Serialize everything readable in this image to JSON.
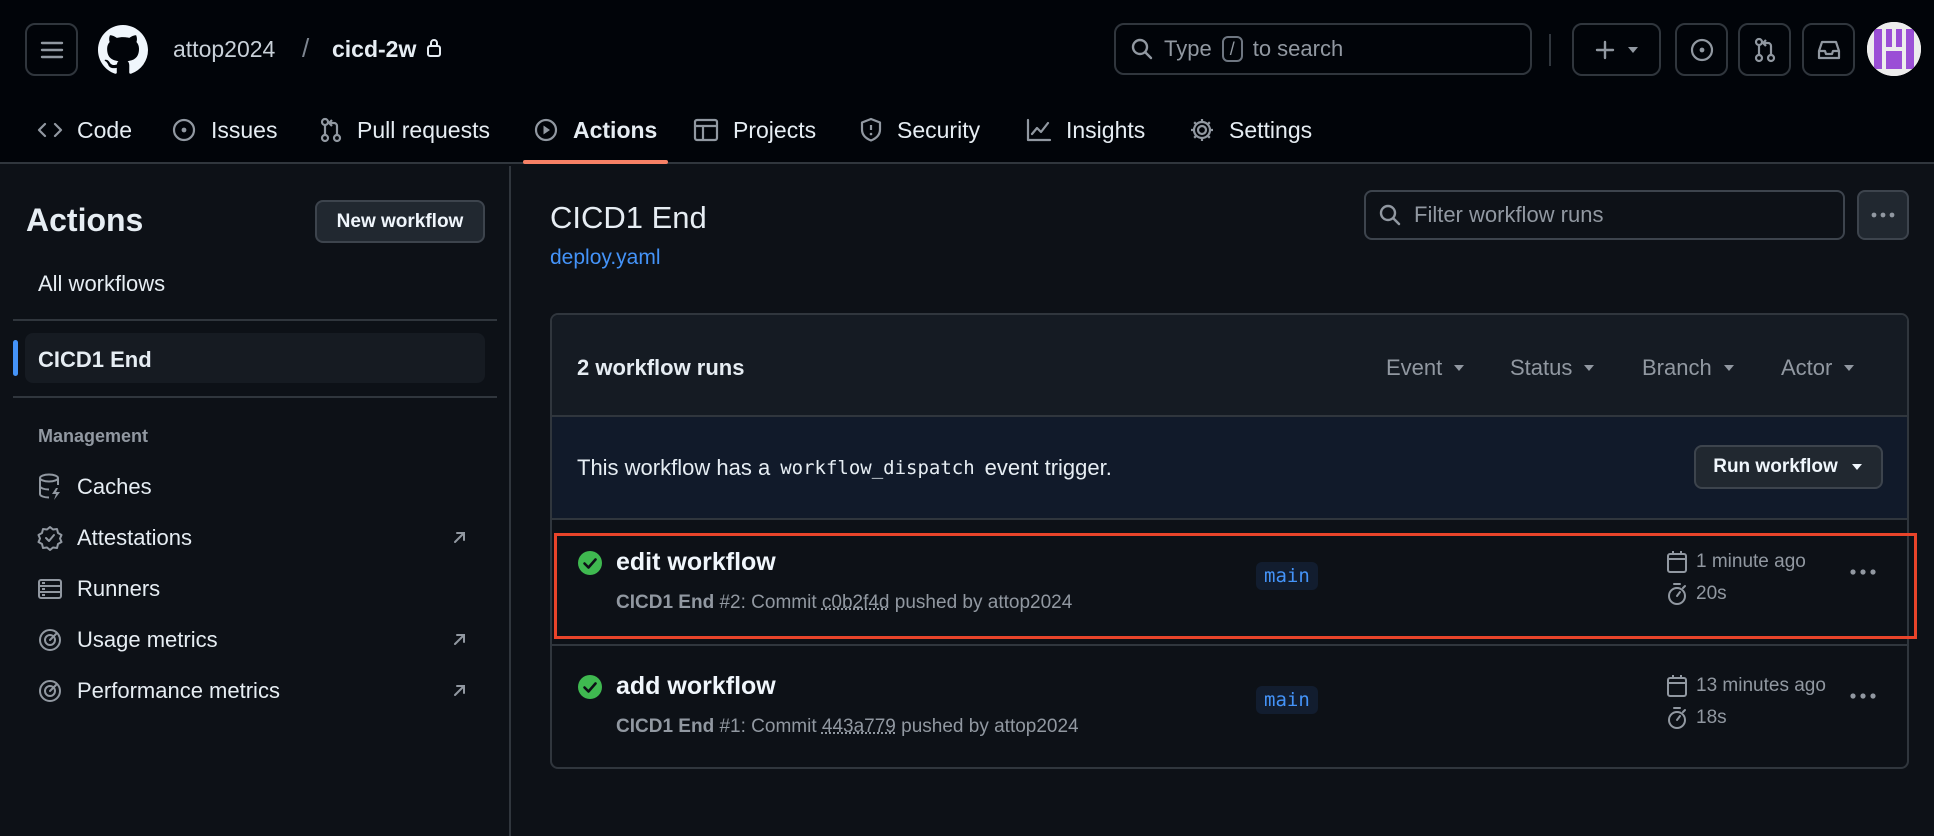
{
  "header": {
    "owner": "attop2024",
    "separator": "/",
    "repo": "cicd-2w",
    "search": {
      "prefix": "Type",
      "key": "/",
      "suffix": "to search"
    }
  },
  "nav": {
    "tabs": [
      {
        "label": "Code",
        "icon": "code-icon"
      },
      {
        "label": "Issues",
        "icon": "issue-icon"
      },
      {
        "label": "Pull requests",
        "icon": "pull-request-icon"
      },
      {
        "label": "Actions",
        "icon": "play-icon",
        "active": true
      },
      {
        "label": "Projects",
        "icon": "table-icon"
      },
      {
        "label": "Security",
        "icon": "shield-icon"
      },
      {
        "label": "Insights",
        "icon": "graph-icon"
      },
      {
        "label": "Settings",
        "icon": "gear-icon"
      }
    ]
  },
  "sidebar": {
    "title": "Actions",
    "new_workflow": "New workflow",
    "all_workflows": "All workflows",
    "selected_workflow": "CICD1 End",
    "management_heading": "Management",
    "items": [
      {
        "label": "Caches",
        "icon": "database-icon",
        "external": false
      },
      {
        "label": "Attestations",
        "icon": "verified-icon",
        "external": true
      },
      {
        "label": "Runners",
        "icon": "server-icon",
        "external": false
      },
      {
        "label": "Usage metrics",
        "icon": "meter-icon",
        "external": true
      },
      {
        "label": "Performance metrics",
        "icon": "meter-icon",
        "external": true
      }
    ]
  },
  "main": {
    "title": "CICD1 End",
    "file": "deploy.yaml",
    "filter_placeholder": "Filter workflow runs",
    "runs_count": "2 workflow runs",
    "filters": [
      "Event",
      "Status",
      "Branch",
      "Actor"
    ],
    "dispatch": {
      "before": "This workflow has a",
      "code": "workflow_dispatch",
      "after": "event trigger."
    },
    "run_workflow": "Run workflow",
    "runs": [
      {
        "title": "edit workflow",
        "workflow": "CICD1 End",
        "number": "#2",
        "commit_label": ": Commit",
        "sha": "c0b2f4d",
        "pushed_by": "pushed by attop2024",
        "branch": "main",
        "time": "1 minute ago",
        "duration": "20s",
        "status": "success"
      },
      {
        "title": "add workflow",
        "workflow": "CICD1 End",
        "number": "#1",
        "commit_label": ": Commit",
        "sha": "443a779",
        "pushed_by": "pushed by attop2024",
        "branch": "main",
        "time": "13 minutes ago",
        "duration": "18s",
        "status": "success"
      }
    ]
  },
  "colors": {
    "accent_blue": "#4493f8",
    "success_green": "#3fb950",
    "active_tab_underline": "#f78166",
    "highlight_box": "#e8442a"
  }
}
